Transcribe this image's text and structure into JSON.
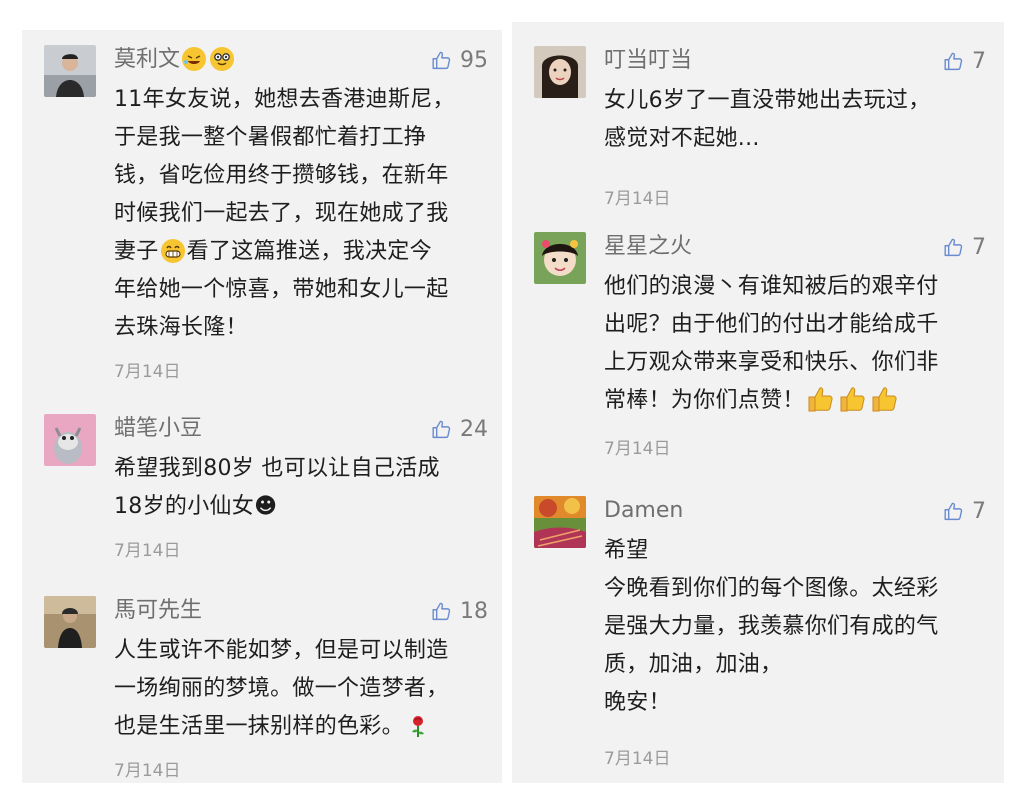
{
  "left_comments": [
    {
      "name": "莫利文",
      "likes": "95",
      "text_1": "11年女友说，她想去香港迪斯尼，",
      "text_2": "于是我一整个暑假都忙着打工挣",
      "text_3": "钱，省吃俭用终于攒够钱，在新年",
      "text_4": "时候我们一起去了，现在她成了我",
      "text_5a": "妻子",
      "text_5b": "看了这篇推送，我决定今",
      "text_6": "年给她一个惊喜，带她和女儿一起",
      "text_7": "去珠海长隆！",
      "date": "7月14日"
    },
    {
      "name": "蜡笔小豆",
      "likes": "24",
      "text_1": "希望我到80岁 也可以让自己活成",
      "text_2": "18岁的小仙女☻",
      "date": "7月14日"
    },
    {
      "name": "馬可先生",
      "likes": "18",
      "text_1": "人生或许不能如梦，但是可以制造",
      "text_2": "一场绚丽的梦境。做一个造梦者，",
      "text_3": "也是生活里一抹别样的色彩。",
      "date": "7月14日"
    }
  ],
  "right_comments": [
    {
      "name": "叮当叮当",
      "likes": "7",
      "text_1": "女儿6岁了一直没带她出去玩过，",
      "text_2": "感觉对不起她...",
      "date": "7月14日"
    },
    {
      "name": "星星之火",
      "likes": "7",
      "text_1": "他们的浪漫丶有谁知被后的艰辛付",
      "text_2": "出呢？由于他们的付出才能给成千",
      "text_3": "上万观众带来享受和快乐、你们非",
      "text_4": "常棒！为你们点赞！",
      "date": "7月14日"
    },
    {
      "name": "Damen",
      "likes": "7",
      "text_1": "希望",
      "text_2": "今晚看到你们的每个图像。太经彩",
      "text_3": "是强大力量，我羡慕你们有成的气",
      "text_4": "质，加油，加油，",
      "text_5": "晚安！",
      "date": "7月14日"
    }
  ],
  "icons": {
    "like": "thumbs-up-outline-icon",
    "emoji_laugh": "rolling-laughing-emoji",
    "emoji_nerd": "nerd-face-emoji",
    "emoji_grin": "grinning-emoji",
    "emoji_rose": "rose-emoji",
    "emoji_thumbs": "thumbs-up-emoji"
  },
  "colors": {
    "panel_bg": "#f2f2f2",
    "name": "#6f6f6f",
    "text": "#1e1e1e",
    "date": "#9b9b9b"
  }
}
